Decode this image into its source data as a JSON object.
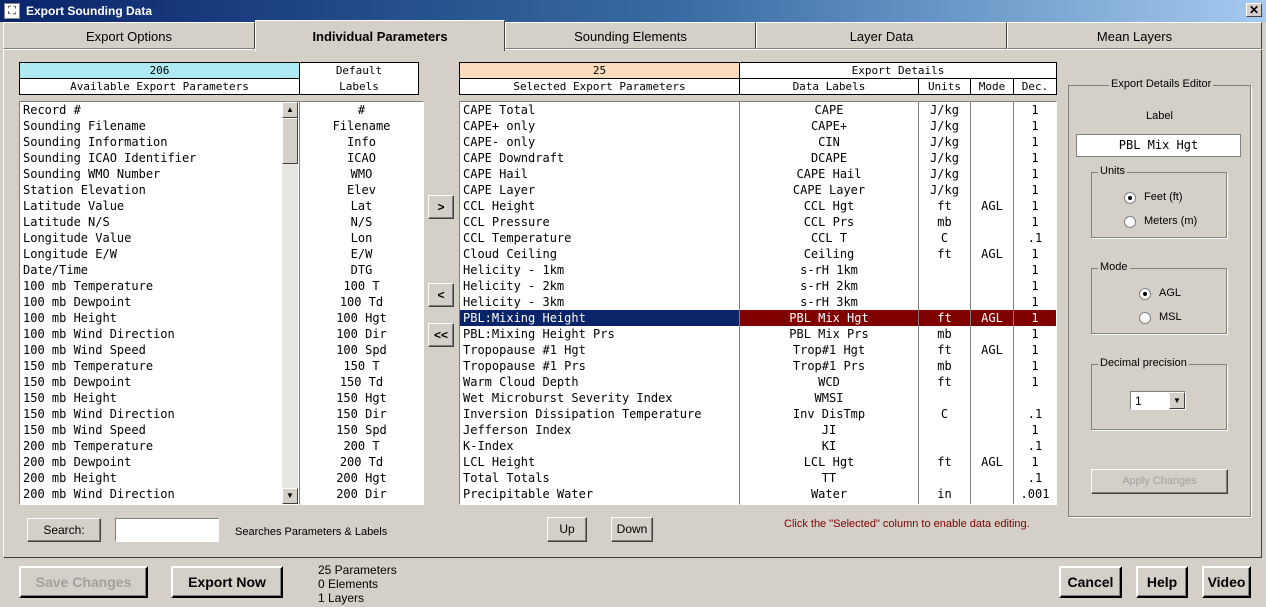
{
  "window": {
    "title": "Export Sounding Data",
    "close_glyph": "✕"
  },
  "tabs": [
    "Export Options",
    "Individual Parameters",
    "Sounding Elements",
    "Layer Data",
    "Mean Layers"
  ],
  "available": {
    "count": "206",
    "header": "Available Export Parameters",
    "labels_header_1": "Default",
    "labels_header_2": "Labels",
    "params": [
      "Record #",
      "Sounding Filename",
      "Sounding Information",
      "Sounding ICAO Identifier",
      "Sounding WMO Number",
      "Station Elevation",
      "Latitude Value",
      "Latitude N/S",
      "Longitude Value",
      "Longitude E/W",
      "Date/Time",
      "100 mb Temperature",
      "100 mb Dewpoint",
      "100 mb Height",
      "100 mb Wind Direction",
      "100 mb Wind Speed",
      "150 mb Temperature",
      "150 mb Dewpoint",
      "150 mb Height",
      "150 mb Wind Direction",
      "150 mb Wind Speed",
      "200 mb Temperature",
      "200 mb Dewpoint",
      "200 mb Height",
      "200 mb Wind Direction"
    ],
    "labels": [
      "#",
      "Filename",
      "Info",
      "ICAO",
      "WMO",
      "Elev",
      "Lat",
      "N/S",
      "Lon",
      "E/W",
      "DTG",
      "100 T",
      "100 Td",
      "100 Hgt",
      "100 Dir",
      "100 Spd",
      "150 T",
      "150 Td",
      "150 Hgt",
      "150 Dir",
      "150 Spd",
      "200 T",
      "200 Td",
      "200 Hgt",
      "200 Dir"
    ]
  },
  "selected": {
    "count": "25",
    "header": "Selected Export Parameters",
    "details_header": "Export Details",
    "col_labels": "Data Labels",
    "col_units": "Units",
    "col_mode": "Mode",
    "col_dec": "Dec.",
    "rows": [
      {
        "p": "CAPE Total",
        "l": "CAPE",
        "u": "J/kg",
        "m": "",
        "d": "1"
      },
      {
        "p": "CAPE+ only",
        "l": "CAPE+",
        "u": "J/kg",
        "m": "",
        "d": "1"
      },
      {
        "p": "CAPE- only",
        "l": "CIN",
        "u": "J/kg",
        "m": "",
        "d": "1"
      },
      {
        "p": "CAPE Downdraft",
        "l": "DCAPE",
        "u": "J/kg",
        "m": "",
        "d": "1"
      },
      {
        "p": "CAPE Hail",
        "l": "CAPE Hail",
        "u": "J/kg",
        "m": "",
        "d": "1"
      },
      {
        "p": "CAPE Layer",
        "l": "CAPE Layer",
        "u": "J/kg",
        "m": "",
        "d": "1"
      },
      {
        "p": "CCL Height",
        "l": "CCL Hgt",
        "u": "ft",
        "m": "AGL",
        "d": "1"
      },
      {
        "p": "CCL Pressure",
        "l": "CCL Prs",
        "u": "mb",
        "m": "",
        "d": "1"
      },
      {
        "p": "CCL Temperature",
        "l": "CCL T",
        "u": "C",
        "m": "",
        "d": ".1"
      },
      {
        "p": "Cloud Ceiling",
        "l": "Ceiling",
        "u": "ft",
        "m": "AGL",
        "d": "1"
      },
      {
        "p": "Helicity - 1km",
        "l": "s-rH 1km",
        "u": "",
        "m": "",
        "d": "1"
      },
      {
        "p": "Helicity - 2km",
        "l": "s-rH 2km",
        "u": "",
        "m": "",
        "d": "1"
      },
      {
        "p": "Helicity - 3km",
        "l": "s-rH 3km",
        "u": "",
        "m": "",
        "d": "1"
      },
      {
        "p": "PBL:Mixing Height",
        "l": "PBL Mix Hgt",
        "u": "ft",
        "m": "AGL",
        "d": "1"
      },
      {
        "p": "PBL:Mixing Height Prs",
        "l": "PBL Mix Prs",
        "u": "mb",
        "m": "",
        "d": "1"
      },
      {
        "p": "Tropopause #1 Hgt",
        "l": "Trop#1 Hgt",
        "u": "ft",
        "m": "AGL",
        "d": "1"
      },
      {
        "p": "Tropopause #1 Prs",
        "l": "Trop#1 Prs",
        "u": "mb",
        "m": "",
        "d": "1"
      },
      {
        "p": "Warm Cloud Depth",
        "l": "WCD",
        "u": "ft",
        "m": "",
        "d": "1"
      },
      {
        "p": "Wet Microburst Severity Index",
        "l": "WMSI",
        "u": "",
        "m": "",
        "d": ""
      },
      {
        "p": "Inversion Dissipation Temperature",
        "l": "Inv DisTmp",
        "u": "C",
        "m": "",
        "d": ".1"
      },
      {
        "p": "Jefferson Index",
        "l": "JI",
        "u": "",
        "m": "",
        "d": "1"
      },
      {
        "p": "K-Index",
        "l": "KI",
        "u": "",
        "m": "",
        "d": ".1"
      },
      {
        "p": "LCL Height",
        "l": "LCL Hgt",
        "u": "ft",
        "m": "AGL",
        "d": "1"
      },
      {
        "p": "Total Totals",
        "l": "TT",
        "u": "",
        "m": "",
        "d": ".1"
      },
      {
        "p": "Precipitable Water",
        "l": "Water",
        "u": "in",
        "m": "",
        "d": ".001"
      }
    ],
    "selected_index": 13
  },
  "move": {
    "add": ">",
    "remove": "<",
    "remove_all": "<<"
  },
  "search": {
    "button": "Search:",
    "value": "",
    "hint": "Searches Parameters & Labels"
  },
  "order": {
    "up": "Up",
    "down": "Down",
    "hint": "Click the \"Selected\" column to enable data editing."
  },
  "editor": {
    "title": "Export Details Editor",
    "label_caption": "Label",
    "label_value": "PBL Mix Hgt",
    "units_group": "Units",
    "units_opt1": "Feet  (ft)",
    "units_opt2": "Meters  (m)",
    "mode_group": "Mode",
    "mode_opt1": "AGL",
    "mode_opt2": "MSL",
    "dec_group": "Decimal precision",
    "dec_value": "1",
    "apply": "Apply Changes"
  },
  "footer": {
    "save": "Save Changes",
    "export": "Export Now",
    "stats": [
      "25  Parameters",
      "0  Elements",
      "1  Layers"
    ],
    "cancel": "Cancel",
    "help": "Help",
    "video": "Video"
  },
  "colors": {
    "count_left_bg": "#aeeaf4",
    "count_right_bg": "#fbdcbc",
    "selection_blue": "#0a246a",
    "selection_red": "#800000",
    "hint_red": "#800000"
  }
}
